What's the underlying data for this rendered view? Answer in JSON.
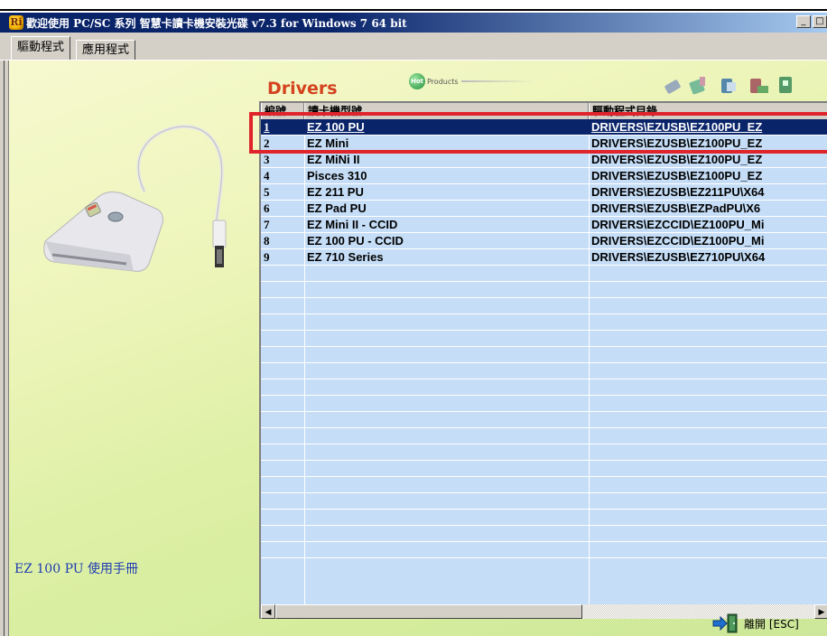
{
  "window": {
    "title": "歡迎使用 PC/SC 系列 智慧卡讀卡機安裝光碟 v7.3 for Windows 7 64 bit",
    "icon_name": "app-logo-icon"
  },
  "tabs": [
    {
      "label": "驅動程式",
      "active": true
    },
    {
      "label": "應用程式",
      "active": false
    }
  ],
  "left_panel": {
    "manual_link": "EZ 100 PU 使用手冊",
    "image": "usb-card-reader"
  },
  "header": {
    "title": "Drivers",
    "hot_badge": "Hot",
    "hot_text": "Products"
  },
  "table": {
    "columns": [
      "編號",
      "讀卡機型號",
      "驅動程式目錄"
    ],
    "rows": [
      {
        "num": "1",
        "model": "EZ 100 PU",
        "path": "DRIVERS\\EZUSB\\EZ100PU_EZ",
        "selected": true
      },
      {
        "num": "2",
        "model": "EZ Mini",
        "path": "DRIVERS\\EZUSB\\EZ100PU_EZ",
        "selected": false
      },
      {
        "num": "3",
        "model": "EZ MiNi II",
        "path": "DRIVERS\\EZUSB\\EZ100PU_EZ",
        "selected": false
      },
      {
        "num": "4",
        "model": "Pisces 310",
        "path": "DRIVERS\\EZUSB\\EZ100PU_EZ",
        "selected": false
      },
      {
        "num": "5",
        "model": "EZ 211 PU",
        "path": "DRIVERS\\EZUSB\\EZ211PU\\X64",
        "selected": false
      },
      {
        "num": "6",
        "model": "EZ Pad PU",
        "path": "DRIVERS\\EZUSB\\EZPadPU\\X6",
        "selected": false
      },
      {
        "num": "7",
        "model": "EZ Mini II - CCID",
        "path": "DRIVERS\\EZCCID\\EZ100PU_Mi",
        "selected": false
      },
      {
        "num": "8",
        "model": "EZ 100 PU - CCID",
        "path": "DRIVERS\\EZCCID\\EZ100PU_Mi",
        "selected": false
      },
      {
        "num": "9",
        "model": "EZ 710 Series",
        "path": "DRIVERS\\EZUSB\\EZ710PU\\X64",
        "selected": false
      }
    ]
  },
  "footer": {
    "exit_label": "離開 [ESC]",
    "exit_icon": "exit-door-icon"
  },
  "colors": {
    "selection": "#0a246a",
    "list_bg": "#c5ddf6",
    "drivers_title": "#d4421f",
    "highlight": "#e0242c"
  }
}
